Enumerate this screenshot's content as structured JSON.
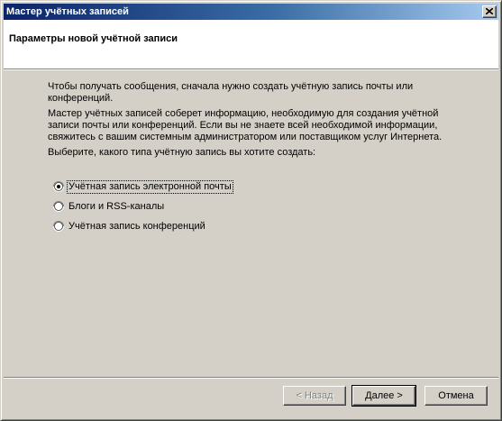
{
  "window": {
    "title": "Мастер учётных записей"
  },
  "header": {
    "title": "Параметры новой учётной записи"
  },
  "content": {
    "paragraph1": "Чтобы получать сообщения, сначала нужно создать учётную запись почты или конференций.",
    "paragraph2": "Мастер учётных записей соберет информацию, необходимую для создания учётной записи почты или конференций. Если вы не знаете всей необходимой информации, свяжитесь с вашим системным администратором или поставщиком услуг Интернета.",
    "paragraph3": "Выберите, какого типа учётную запись вы хотите создать:"
  },
  "options": [
    {
      "label": "Учётная запись электронной почты",
      "selected": true
    },
    {
      "label": "Блоги и RSS-каналы",
      "selected": false
    },
    {
      "label": "Учётная запись конференций",
      "selected": false
    }
  ],
  "buttons": {
    "back": "< Назад",
    "next": "Далее >",
    "cancel": "Отмена"
  },
  "colors": {
    "title_bar_start": "#0a246a",
    "title_bar_end": "#a6caf0",
    "face": "#d4d0c8"
  },
  "icons": {
    "close": "close-icon"
  }
}
